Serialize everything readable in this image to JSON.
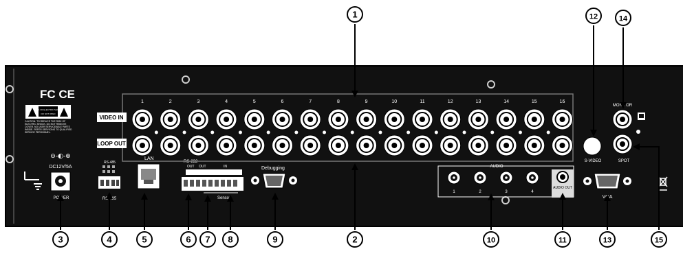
{
  "panel": {
    "compliance_marks": "FC CE",
    "warning_label_top": "RISK OF ELECTRIC SHOCK",
    "warning_label_sub": "DO NOT OPEN",
    "caution_text": "CAUTION: TO REDUCE THE RISK OF ELECTRIC SHOCK, DO NOT REMOVE COVER. NO USER SERVICEABLE PARTS INSIDE. REFER SERVICING TO QUALIFIED SERVICE PERSONNEL."
  },
  "bnc": {
    "channel_numbers": [
      "1",
      "2",
      "3",
      "4",
      "5",
      "6",
      "7",
      "8",
      "9",
      "10",
      "11",
      "12",
      "13",
      "14",
      "15",
      "16"
    ],
    "video_in_label": "VIDEO IN",
    "loop_out_label": "LOOP OUT"
  },
  "power": {
    "polarity_symbol": "⊖-◐-⊕",
    "rating": "DC12V/5A",
    "label": "POWER"
  },
  "rs485": {
    "header": "RS-485",
    "label": "RS-485"
  },
  "lan": {
    "label": "LAN"
  },
  "terminal": {
    "rs232_label": "RS-232",
    "out_label": "OUT",
    "in_label": "IN",
    "sensor_label": "Sensor"
  },
  "debugging": {
    "label": "Debugging"
  },
  "audio": {
    "group_label": "AUDIO",
    "inputs": [
      "1",
      "2",
      "3",
      "4"
    ],
    "out_label": "AUDIO OUT"
  },
  "svideo": {
    "label": "S-VIDEO"
  },
  "monitor": {
    "label": "MONITOR"
  },
  "spot": {
    "label": "SPOT"
  },
  "vga": {
    "label": "VGA"
  },
  "callouts": [
    "1",
    "2",
    "3",
    "4",
    "5",
    "6",
    "7",
    "8",
    "9",
    "10",
    "11",
    "12",
    "13",
    "14",
    "15"
  ]
}
